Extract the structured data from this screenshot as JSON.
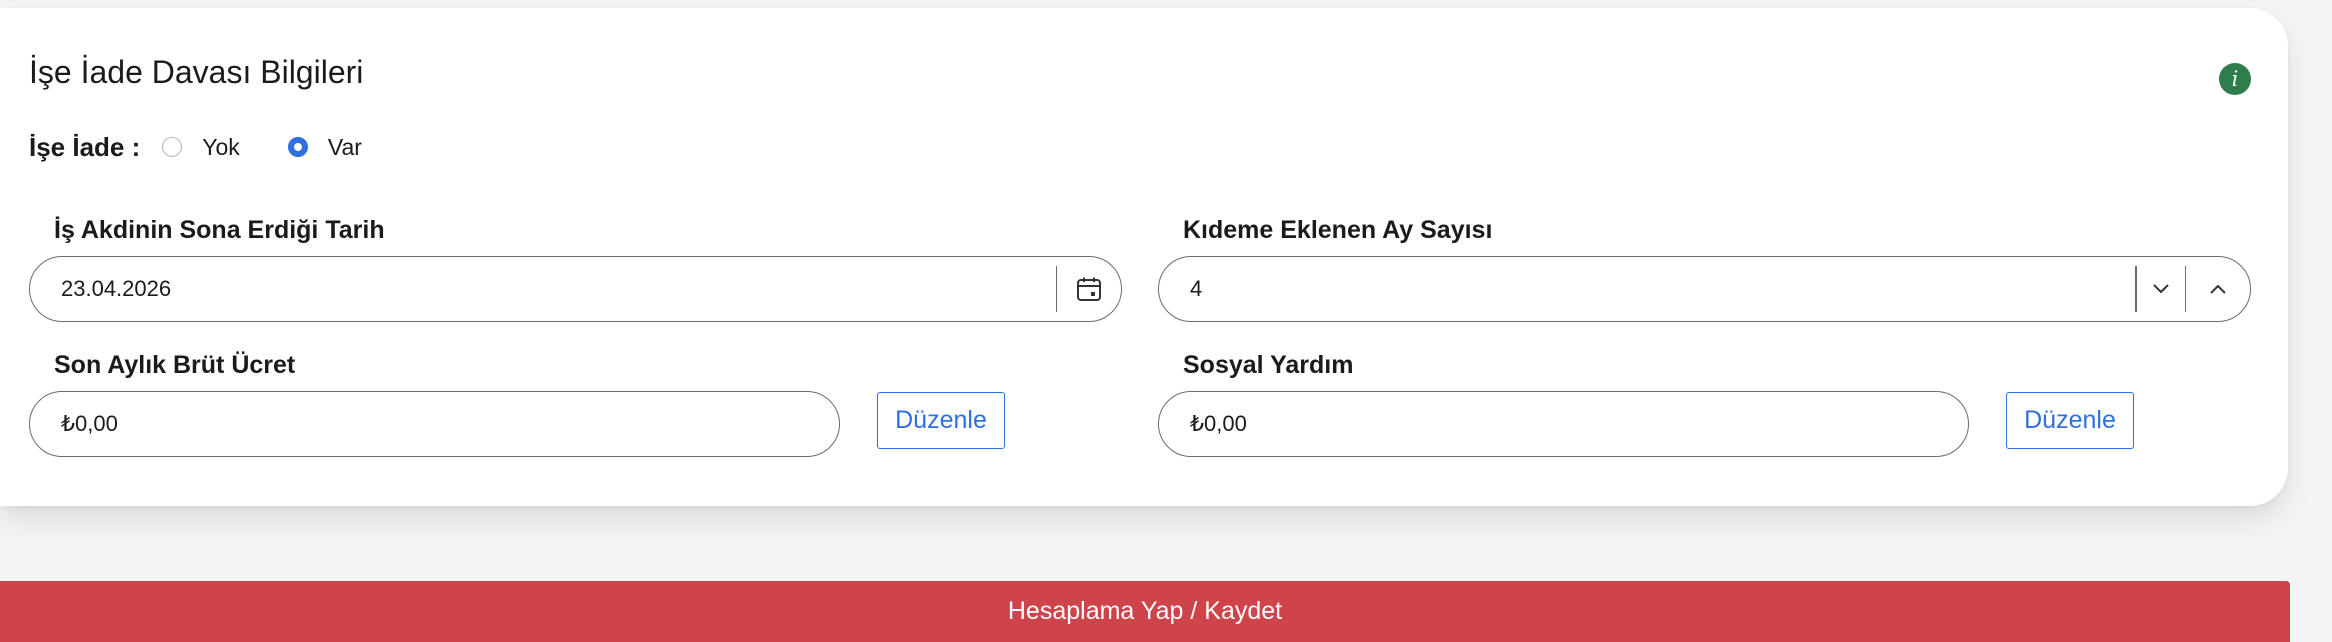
{
  "section": {
    "title": "İşe İade Davası Bilgileri",
    "info_icon": "info-icon"
  },
  "reinstatement": {
    "label": "İşe İade :",
    "options": [
      {
        "label": "Yok",
        "selected": false
      },
      {
        "label": "Var",
        "selected": true
      }
    ]
  },
  "fields": {
    "end_date": {
      "label": "İş Akdinin Sona Erdiği Tarih",
      "value": "23.04.2026",
      "icon": "calendar-icon"
    },
    "added_months": {
      "label": "Kıdeme Eklenen Ay Sayısı",
      "value": "4"
    },
    "gross_salary": {
      "label": "Son Aylık Brüt Ücret",
      "value": "₺0,00",
      "edit_label": "Düzenle"
    },
    "social_aid": {
      "label": "Sosyal Yardım",
      "value": "₺0,00",
      "edit_label": "Düzenle"
    }
  },
  "submit": {
    "label": "Hesaplama Yap / Kaydet"
  },
  "colors": {
    "accent": "#2f6fe0",
    "submit": "#cf434b",
    "info": "#2e7d4a"
  }
}
